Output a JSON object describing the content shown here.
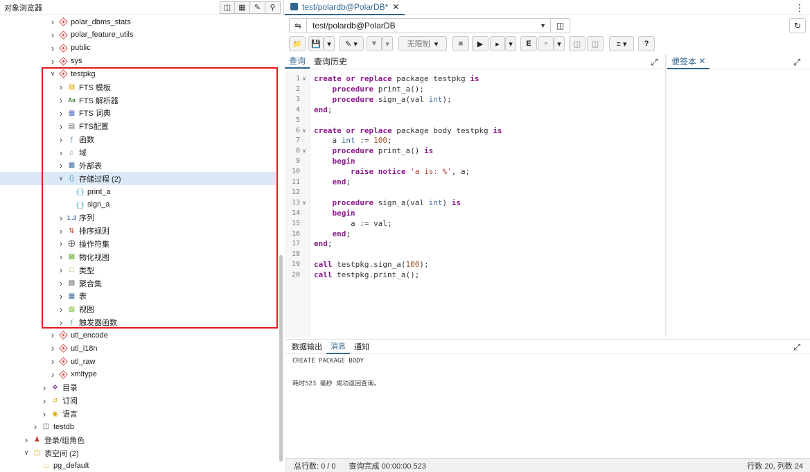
{
  "left_panel": {
    "title": "对象浏览器",
    "header_icons": [
      "database-icon",
      "table-icon",
      "query-tool-icon",
      "search-icon"
    ],
    "tree": [
      {
        "label": "polar_dbms_stats",
        "icon": "package-icon",
        "level": 5,
        "chevron": "right"
      },
      {
        "label": "polar_feature_utils",
        "icon": "package-icon",
        "level": 5,
        "chevron": "right"
      },
      {
        "label": "public",
        "icon": "package-icon",
        "level": 5,
        "chevron": "right"
      },
      {
        "label": "sys",
        "icon": "package-icon",
        "level": 5,
        "chevron": "right"
      },
      {
        "label": "testpkg",
        "icon": "package-icon",
        "level": 5,
        "chevron": "down"
      },
      {
        "label": "FTS 模板",
        "icon": "fts-template-icon",
        "level": 6,
        "chevron": "right"
      },
      {
        "label": "FTS 解析器",
        "icon": "fts-parser-icon",
        "level": 6,
        "chevron": "right",
        "glyph": "Aa"
      },
      {
        "label": "FTS 词典",
        "icon": "fts-dictionary-icon",
        "level": 6,
        "chevron": "right"
      },
      {
        "label": "FTS配置",
        "icon": "fts-config-icon",
        "level": 6,
        "chevron": "right"
      },
      {
        "label": "函数",
        "icon": "function-icon",
        "level": 6,
        "chevron": "right"
      },
      {
        "label": "域",
        "icon": "domain-icon",
        "level": 6,
        "chevron": "right"
      },
      {
        "label": "外部表",
        "icon": "foreign-table-icon",
        "level": 6,
        "chevron": "right"
      },
      {
        "label": "存储过程 (2)",
        "icon": "procedure-icon",
        "level": 6,
        "chevron": "down",
        "selected": true
      },
      {
        "label": "print_a",
        "icon": "braces-icon",
        "level": 7,
        "chevron": ""
      },
      {
        "label": "sign_a",
        "icon": "braces-icon",
        "level": 7,
        "chevron": ""
      },
      {
        "label": "序列",
        "icon": "sequence-icon",
        "level": 6,
        "chevron": "right",
        "glyph": "1..3"
      },
      {
        "label": "排序规则",
        "icon": "collation-icon",
        "level": 6,
        "chevron": "right"
      },
      {
        "label": "操作符集",
        "icon": "operator-icon",
        "level": 6,
        "chevron": "right"
      },
      {
        "label": "物化视图",
        "icon": "materialized-view-icon",
        "level": 6,
        "chevron": "right"
      },
      {
        "label": "类型",
        "icon": "type-icon",
        "level": 6,
        "chevron": "right"
      },
      {
        "label": "聚合集",
        "icon": "aggregate-icon",
        "level": 6,
        "chevron": "right"
      },
      {
        "label": "表",
        "icon": "table-icon",
        "level": 6,
        "chevron": "right"
      },
      {
        "label": "视图",
        "icon": "view-icon",
        "level": 6,
        "chevron": "right"
      },
      {
        "label": "触发器函数",
        "icon": "trigger-function-icon",
        "level": 6,
        "chevron": "right"
      },
      {
        "label": "utl_encode",
        "icon": "package-icon",
        "level": 5,
        "chevron": "right"
      },
      {
        "label": "utl_i18n",
        "icon": "package-icon",
        "level": 5,
        "chevron": "right"
      },
      {
        "label": "utl_raw",
        "icon": "package-icon",
        "level": 5,
        "chevron": "right"
      },
      {
        "label": "xmltype",
        "icon": "package-icon",
        "level": 5,
        "chevron": "right"
      },
      {
        "label": "目录",
        "icon": "catalog-icon",
        "level": 4,
        "chevron": "right"
      },
      {
        "label": "订阅",
        "icon": "subscription-icon",
        "level": 4,
        "chevron": "right"
      },
      {
        "label": "语言",
        "icon": "language-icon",
        "level": 4,
        "chevron": "right"
      },
      {
        "label": "testdb",
        "icon": "database-icon",
        "level": 3,
        "chevron": "right"
      },
      {
        "label": "登录/组角色",
        "icon": "roles-icon",
        "level": 2,
        "chevron": "right"
      },
      {
        "label": "表空间 (2)",
        "icon": "tablespace-icon",
        "level": 2,
        "chevron": "down"
      },
      {
        "label": "pg_default",
        "icon": "folder-icon",
        "level": 3,
        "chevron": ""
      }
    ]
  },
  "main": {
    "tab_title": "test/polardb@PolarDB*",
    "connection": "test/polardb@PolarDB",
    "limit_label": "无限制",
    "editor_tabs": [
      "查询",
      "查询历史"
    ],
    "notes_tab": "便签本",
    "code_lines": [
      "create or replace package testpkg is",
      "    procedure print_a();",
      "    procedure sign_a(val int);",
      "end;",
      "",
      "create or replace package body testpkg is",
      "    a int := 100;",
      "    procedure print_a() is",
      "    begin",
      "        raise notice 'a is: %', a;",
      "    end;",
      "",
      "    procedure sign_a(val int) is",
      "    begin",
      "        a := val;",
      "    end;",
      "end;",
      "",
      "call testpkg.sign_a(100);",
      "call testpkg.print_a();"
    ],
    "fold_lines": [
      1,
      6,
      8,
      13
    ],
    "bottom_tabs": [
      "数据输出",
      "消息",
      "通知"
    ],
    "output_lines": [
      "CREATE PACKAGE BODY",
      "",
      "",
      "耗时523 毫秒 成功返回查询。"
    ],
    "status": {
      "total_rows": "总行数: 0 / 0",
      "query_done": "查询完成 00:00:00.523",
      "cursor_pos": "行数 20, 列数 24"
    }
  },
  "colors": {
    "accent": "#326690",
    "highlight_box": "#e21b1b",
    "selection": "#dbe9f7",
    "keyword": "#8b1a8b"
  }
}
